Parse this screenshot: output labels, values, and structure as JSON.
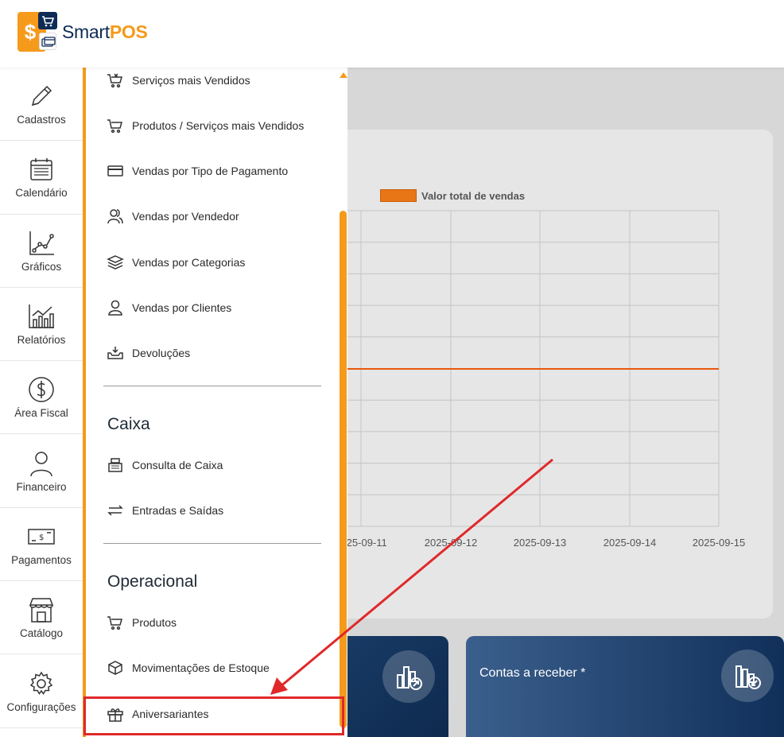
{
  "app": {
    "name_prefix": "Smart",
    "name_suffix": "POS",
    "brand_color": "#f59a1b",
    "navy_color": "#0d2b55"
  },
  "rail": [
    {
      "label": "Cadastros",
      "icon": "pencil-icon"
    },
    {
      "label": "Calendário",
      "icon": "calendar-icon"
    },
    {
      "label": "Gráficos",
      "icon": "line-chart-icon"
    },
    {
      "label": "Relatórios",
      "icon": "bar-chart-icon"
    },
    {
      "label": "Área Fiscal",
      "icon": "dollar-circle-icon"
    },
    {
      "label": "Financeiro",
      "icon": "person-icon"
    },
    {
      "label": "Pagamentos",
      "icon": "banknote-icon"
    },
    {
      "label": "Catálogo",
      "icon": "store-icon"
    },
    {
      "label": "Configurações",
      "icon": "gear-icon"
    }
  ],
  "drawer": {
    "reports": [
      {
        "label": "Serviços mais Vendidos",
        "icon": "cart-tools-icon"
      },
      {
        "label": "Produtos / Serviços mais Vendidos",
        "icon": "cart-icon"
      },
      {
        "label": "Vendas por Tipo de Pagamento",
        "icon": "credit-card-icon"
      },
      {
        "label": "Vendas por Vendedor",
        "icon": "users-icon"
      },
      {
        "label": "Vendas por Categorias",
        "icon": "layers-icon"
      },
      {
        "label": "Vendas por Clientes",
        "icon": "user-icon"
      },
      {
        "label": "Devoluções",
        "icon": "tray-icon"
      }
    ],
    "caixa_title": "Caixa",
    "caixa": [
      {
        "label": "Consulta de Caixa",
        "icon": "cash-register-icon"
      },
      {
        "label": "Entradas e Saídas",
        "icon": "swap-arrows-icon"
      }
    ],
    "operacional_title": "Operacional",
    "operacional": [
      {
        "label": "Produtos",
        "icon": "cart-icon"
      },
      {
        "label": "Movimentações de Estoque",
        "icon": "box-icon"
      },
      {
        "label": "Aniversariantes",
        "icon": "gift-icon"
      }
    ]
  },
  "chart_data": {
    "type": "line",
    "series": [
      {
        "name": "Valor total de vendas",
        "color": "#e8590c"
      }
    ],
    "x_tick_labels": [
      "2025-09-11",
      "2025-09-12",
      "2025-09-13",
      "2025-09-14",
      "2025-09-15"
    ],
    "grid": true,
    "legend": "top-left"
  },
  "cards": {
    "receivable_title": "Contas a receber *"
  }
}
